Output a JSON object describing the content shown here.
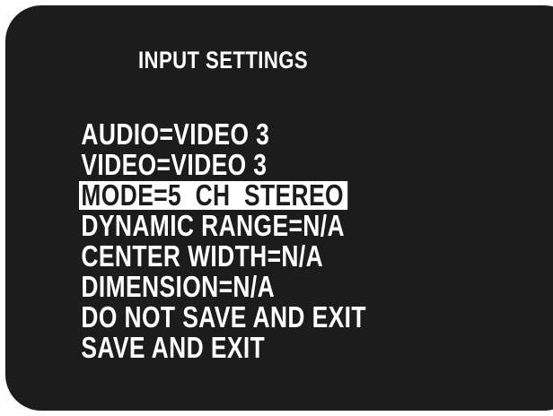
{
  "osd": {
    "title": "INPUT SETTINGS",
    "selected_index": 2,
    "items": [
      {
        "label": "AUDIO=VIDEO 3"
      },
      {
        "label": "VIDEO=VIDEO 3"
      },
      {
        "label": "MODE=5  CH  STEREO"
      },
      {
        "label": "DYNAMIC RANGE=N/A"
      },
      {
        "label": "CENTER WIDTH=N/A"
      },
      {
        "label": "DIMENSION=N/A"
      },
      {
        "label": "DO NOT SAVE AND EXIT"
      },
      {
        "label": "SAVE AND EXIT"
      }
    ]
  },
  "colors": {
    "background": "#1c1c1c",
    "text": "#ffffff",
    "highlight_background": "#ffffff",
    "highlight_text": "#1c1c1c"
  }
}
